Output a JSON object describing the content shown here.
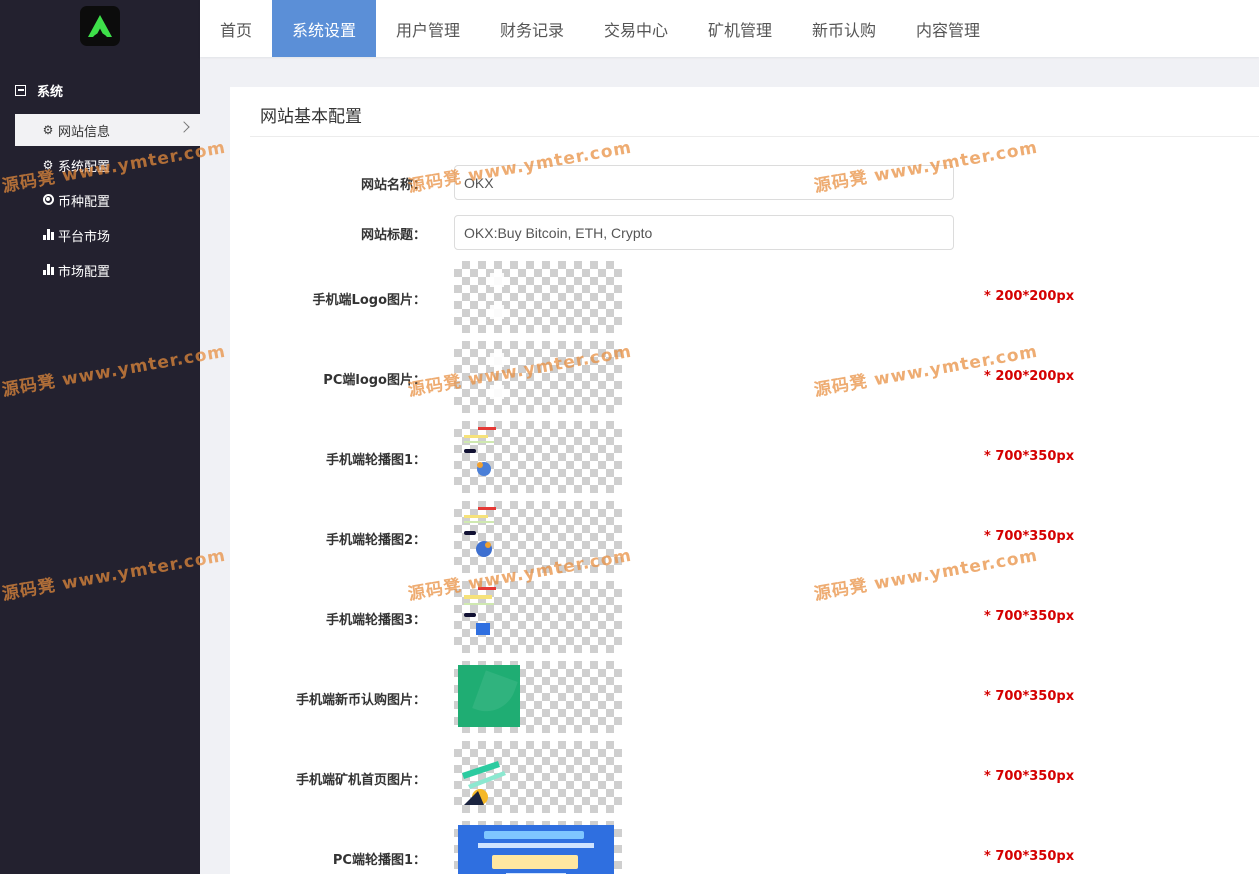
{
  "sidebar": {
    "section_title": "系统",
    "items": [
      {
        "label": "网站信息",
        "icon": "gear-icon",
        "active": true
      },
      {
        "label": "系统配置",
        "icon": "gear-icon",
        "active": false
      },
      {
        "label": "币种配置",
        "icon": "target-icon",
        "active": false
      },
      {
        "label": "平台市场",
        "icon": "bar-chart-icon",
        "active": false
      },
      {
        "label": "市场配置",
        "icon": "bar-chart-icon",
        "active": false
      }
    ]
  },
  "topnav": {
    "tabs": [
      {
        "label": "首页",
        "active": false
      },
      {
        "label": "系统设置",
        "active": true
      },
      {
        "label": "用户管理",
        "active": false
      },
      {
        "label": "财务记录",
        "active": false
      },
      {
        "label": "交易中心",
        "active": false
      },
      {
        "label": "矿机管理",
        "active": false
      },
      {
        "label": "新币认购",
        "active": false
      },
      {
        "label": "内容管理",
        "active": false
      }
    ],
    "active_color": "#5b8fd7"
  },
  "panel": {
    "title": "网站基本配置",
    "fields": {
      "site_name": {
        "label": "网站名称：",
        "value": "OKX"
      },
      "site_title": {
        "label": "网站标题：",
        "value": "OKX:Buy Bitcoin, ETH, Crypto"
      }
    },
    "images": [
      {
        "label": "手机端Logo图片：",
        "hint": "* 200*200px"
      },
      {
        "label": "PC端logo图片：",
        "hint": "* 200*200px"
      },
      {
        "label": "手机端轮播图1：",
        "hint": "* 700*350px"
      },
      {
        "label": "手机端轮播图2：",
        "hint": "* 700*350px"
      },
      {
        "label": "手机端轮播图3：",
        "hint": "* 700*350px"
      },
      {
        "label": "手机端新币认购图片：",
        "hint": "* 700*350px"
      },
      {
        "label": "手机端矿机首页图片：",
        "hint": "* 700*350px"
      },
      {
        "label": "PC端轮播图1：",
        "hint": "* 700*350px"
      }
    ]
  },
  "watermark": {
    "brand": "源码凳",
    "url": "www.ymter.com"
  },
  "colors": {
    "sidebar_bg": "#23212f",
    "hint_red": "#d40000",
    "logo_green": "#3ee04a"
  }
}
